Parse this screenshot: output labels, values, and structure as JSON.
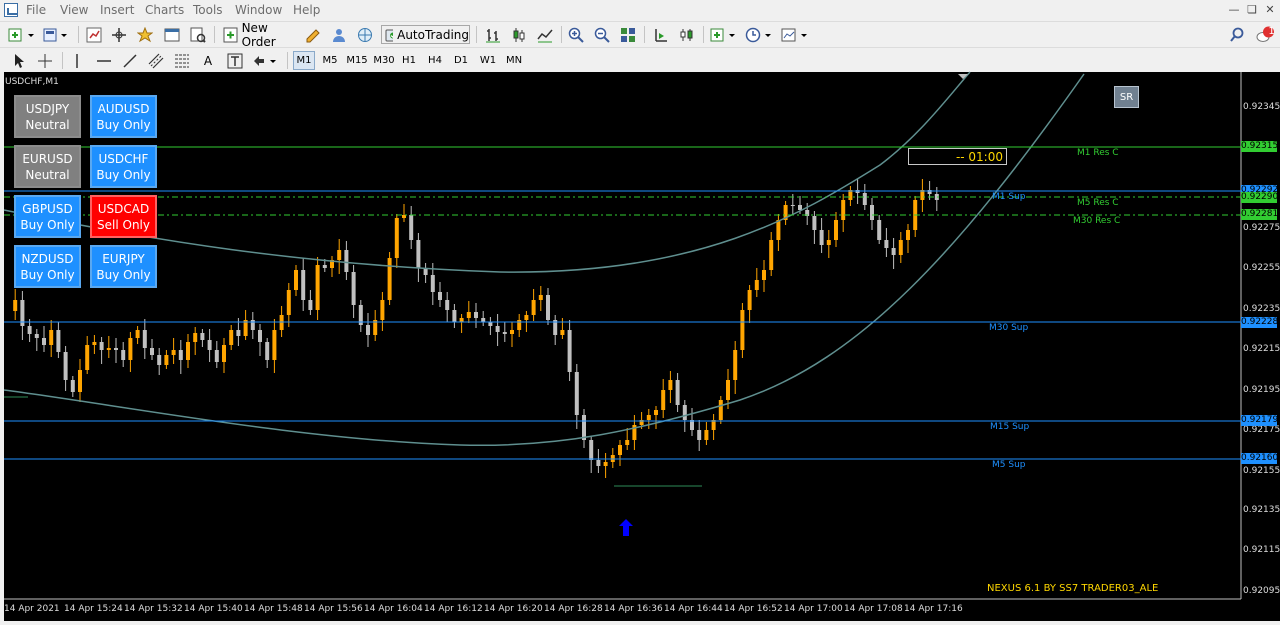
{
  "menu": [
    "File",
    "View",
    "Insert",
    "Charts",
    "Tools",
    "Window",
    "Help"
  ],
  "toolbar1": {
    "new_order_label": "New Order",
    "autotrading_label": "AutoTrading",
    "notification_count": "1"
  },
  "timeframes": [
    {
      "label": "M1",
      "active": true
    },
    {
      "label": "M5",
      "active": false
    },
    {
      "label": "M15",
      "active": false
    },
    {
      "label": "M30",
      "active": false
    },
    {
      "label": "H1",
      "active": false
    },
    {
      "label": "H4",
      "active": false
    },
    {
      "label": "D1",
      "active": false
    },
    {
      "label": "W1",
      "active": false
    },
    {
      "label": "MN",
      "active": false
    }
  ],
  "chart": {
    "symbol_title": "USDCHF,M1",
    "sr_button": "SR",
    "timer_text": "-- 01:00",
    "footer_text": "NEXUS 6.1 BY SS7 TRADER03_ALE",
    "pairs": [
      {
        "name": "USDJPY",
        "status": "Neutral",
        "state": "neutral"
      },
      {
        "name": "AUDUSD",
        "status": "Buy Only",
        "state": "buy"
      },
      {
        "name": "EURUSD",
        "status": "Neutral",
        "state": "neutral"
      },
      {
        "name": "USDCHF",
        "status": "Buy Only",
        "state": "buy"
      },
      {
        "name": "GBPUSD",
        "status": "Buy Only",
        "state": "buy"
      },
      {
        "name": "USDCAD",
        "status": "Sell Only",
        "state": "sell"
      },
      {
        "name": "NZDUSD",
        "status": "Buy Only",
        "state": "buy"
      },
      {
        "name": "EURJPY",
        "status": "Buy Only",
        "state": "buy"
      }
    ],
    "levels": [
      {
        "label": "M1 Res C",
        "price": "0.92315",
        "color": "#32cd32"
      },
      {
        "label": "M1 Sup",
        "price": "0.92292",
        "color": "#1e90ff"
      },
      {
        "label": "M5 Res C",
        "price": "0.92290",
        "color": "#32cd32"
      },
      {
        "label": "M30 Res C",
        "price": "0.92281",
        "color": "#32cd32"
      },
      {
        "label": "M30 Sup",
        "price": "0.92228",
        "color": "#1e90ff"
      },
      {
        "label": "M15 Sup",
        "price": "0.92179",
        "color": "#1e90ff"
      },
      {
        "label": "M5 Sup",
        "price": "0.92160",
        "color": "#1e90ff"
      }
    ],
    "price_ticks": [
      "0.92345",
      "0.92275",
      "0.92255",
      "0.92235",
      "0.92215",
      "0.92195",
      "0.92175",
      "0.92155",
      "0.92135",
      "0.92115",
      "0.92095"
    ],
    "time_ticks": [
      "14 Apr 2021",
      "14 Apr 15:24",
      "14 Apr 15:32",
      "14 Apr 15:40",
      "14 Apr 15:48",
      "14 Apr 15:56",
      "14 Apr 16:04",
      "14 Apr 16:12",
      "14 Apr 16:20",
      "14 Apr 16:28",
      "14 Apr 16:36",
      "14 Apr 16:44",
      "14 Apr 16:52",
      "14 Apr 17:00",
      "14 Apr 17:08",
      "14 Apr 17:16"
    ]
  },
  "colors": {
    "bull": "#ffa500",
    "bear": "#c0c0c0",
    "buy_arrow": "#0000ff"
  }
}
